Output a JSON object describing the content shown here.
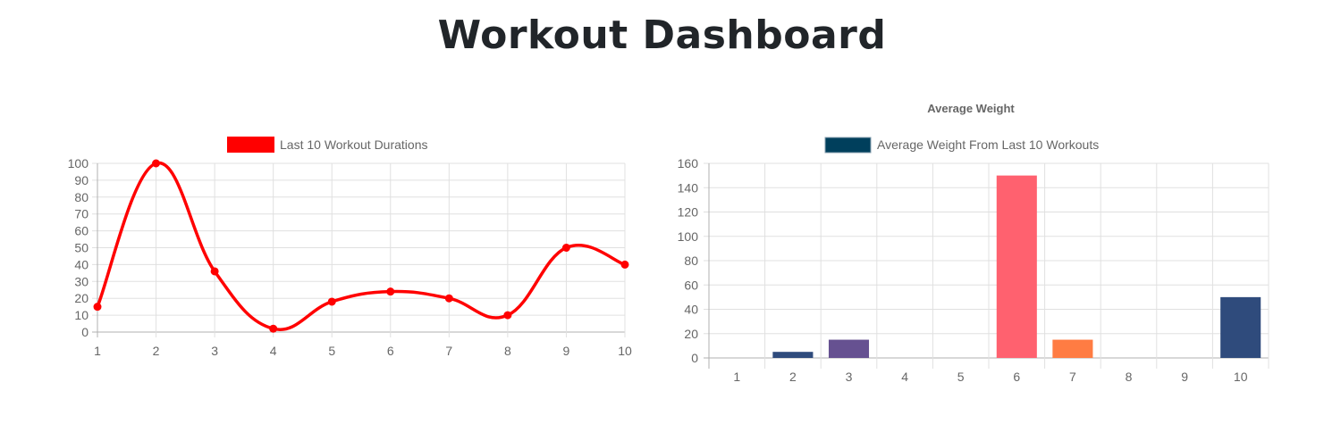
{
  "page": {
    "title": "Workout Dashboard"
  },
  "colors": {
    "line": "#ff0000",
    "grid": "#e0e0e0",
    "axis": "#b0b0b0",
    "tick_text": "#666666",
    "legend_text": "#666666",
    "title_text": "#666666",
    "bar_legend_fill": "#003f5c",
    "bar_colors": [
      "#003f5c",
      "#2f4b7c",
      "#665191",
      "#a05195",
      "#d45087",
      "#ff616f",
      "#ff7c43",
      "#ffa600",
      "#003f5c",
      "#2f4b7c"
    ]
  },
  "chart_data": [
    {
      "type": "line",
      "title": "",
      "legend": "Last 10 Workout Durations",
      "legend_position": "top",
      "x": [
        "1",
        "2",
        "3",
        "4",
        "5",
        "6",
        "7",
        "8",
        "9",
        "10"
      ],
      "values": [
        15,
        100,
        36,
        2,
        18,
        24,
        20,
        10,
        50,
        40
      ],
      "ylim": [
        0,
        100
      ],
      "yticks": [
        0,
        10,
        20,
        30,
        40,
        50,
        60,
        70,
        80,
        90,
        100
      ],
      "grid": true,
      "smooth": true
    },
    {
      "type": "bar",
      "title": "Average Weight",
      "legend": "Average Weight From Last 10 Workouts",
      "legend_position": "top",
      "categories": [
        "1",
        "2",
        "3",
        "4",
        "5",
        "6",
        "7",
        "8",
        "9",
        "10"
      ],
      "values": [
        0,
        5,
        15,
        0,
        0,
        150,
        15,
        0,
        0,
        50
      ],
      "ylim": [
        0,
        160
      ],
      "yticks": [
        0,
        20,
        40,
        60,
        80,
        100,
        120,
        140,
        160
      ],
      "grid": true
    }
  ]
}
